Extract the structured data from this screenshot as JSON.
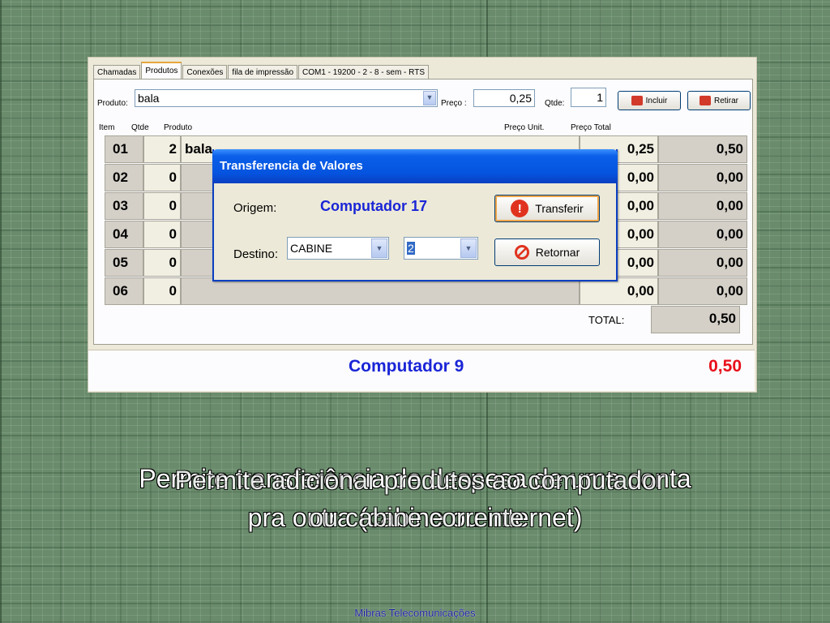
{
  "tabs": [
    "Chamadas",
    "Produtos",
    "Conexões",
    "fila de impressão",
    "COM1 - 19200 - 2 - 8 - sem - RTS"
  ],
  "active_tab": "Produtos",
  "form": {
    "produto_label": "Produto:",
    "produto_value": "bala",
    "preco_label": "Preço :",
    "preco_value": "0,25",
    "qtde_label": "Qtde:",
    "qtde_value": "1",
    "incluir_label": "Incluir",
    "retirar_label": "Retirar"
  },
  "grid": {
    "headers": {
      "item": "Item",
      "qtde": "Qtde",
      "produto": "Produto",
      "preco_unit": "Preço Unit.",
      "preco_total": "Preço Total"
    },
    "rows": [
      {
        "item": "01",
        "qtde": "2",
        "produto": "bala",
        "unit": "0,25",
        "total": "0,50"
      },
      {
        "item": "02",
        "qtde": "0",
        "produto": "",
        "unit": "0,00",
        "total": "0,00"
      },
      {
        "item": "03",
        "qtde": "0",
        "produto": "",
        "unit": "0,00",
        "total": "0,00"
      },
      {
        "item": "04",
        "qtde": "0",
        "produto": "",
        "unit": "0,00",
        "total": "0,00"
      },
      {
        "item": "05",
        "qtde": "0",
        "produto": "",
        "unit": "0,00",
        "total": "0,00"
      },
      {
        "item": "06",
        "qtde": "0",
        "produto": "",
        "unit": "0,00",
        "total": "0,00"
      }
    ],
    "total_label": "TOTAL:",
    "total_value": "0,50"
  },
  "status": {
    "computer": "Computador 9",
    "amount": "0,50"
  },
  "dialog": {
    "title": "Transferencia de Valores",
    "origem_label": "Origem:",
    "origem_value": "Computador 17",
    "destino_label": "Destino:",
    "destino_value": "CABINE",
    "destino_num": "2",
    "transferir_label": "Transferir",
    "retornar_label": "Retornar"
  },
  "caption": {
    "line1_a": "Permite transferência de despesa de uma conta",
    "line1_b": "Permite adicionar produtos ao computador",
    "line2_a": "pra outra (cabine ou internet)",
    "line2_b": "ou cabine corrente"
  },
  "footer": "Mibras Telecomunicações",
  "colors": {
    "accent_blue": "#1a25d6",
    "amount_red": "#e8101a",
    "title_bar": "#0554e0"
  }
}
